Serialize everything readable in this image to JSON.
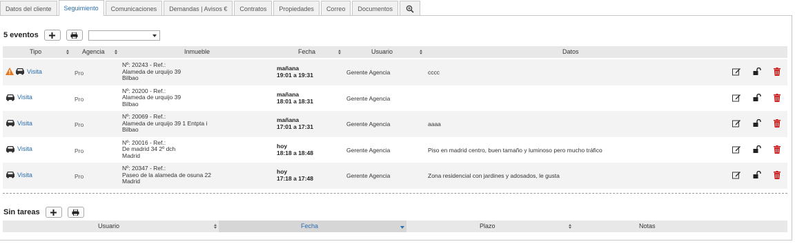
{
  "tabs": [
    {
      "label": "Datos del cliente"
    },
    {
      "label": "Seguimiento"
    },
    {
      "label": "Comunicaciones"
    },
    {
      "label": "Demandas | Avisos €"
    },
    {
      "label": "Contratos"
    },
    {
      "label": "Propiedades"
    },
    {
      "label": "Correo"
    },
    {
      "label": "Documentos"
    },
    {
      "icon": "zoom-icon"
    }
  ],
  "active_tab": "Seguimiento",
  "events": {
    "title": "5 eventos",
    "filter_value": "",
    "columns": {
      "tipo": "Tipo",
      "agencia": "Agencia",
      "inmueble": "Inmueble",
      "fecha": "Fecha",
      "usuario": "Usuario",
      "datos": "Datos"
    },
    "rows": [
      {
        "warning": true,
        "tipo": "Visita",
        "agencia": "Pro",
        "inm1": "Nº: 20243 - Ref.:",
        "inm2": "Alameda de urquijo 39",
        "inm3": "Bilbao",
        "fecha1": "mañana",
        "fecha2": "19:01 a 19:31",
        "usuario": "Gerente Agencia",
        "datos": "cccc"
      },
      {
        "warning": false,
        "tipo": "Visita",
        "agencia": "Pro",
        "inm1": "Nº: 20200 - Ref.:",
        "inm2": "Alameda de urquijo 39",
        "inm3": "Bilbao",
        "fecha1": "mañana",
        "fecha2": "18:01 a 18:31",
        "usuario": "Gerente Agencia",
        "datos": ""
      },
      {
        "warning": false,
        "tipo": "Visita",
        "agencia": "Pro",
        "inm1": "Nº: 20069 - Ref.:",
        "inm2": "Alameda de urquijo 39 1 Entpta i",
        "inm3": "Bilbao",
        "fecha1": "mañana",
        "fecha2": "17:01 a 17:31",
        "usuario": "Gerente Agencia",
        "datos": "aaaa"
      },
      {
        "warning": false,
        "tipo": "Visita",
        "agencia": "Pro",
        "inm1": "Nº: 20016 - Ref.:",
        "inm2": "De madrid 34 2º dch",
        "inm3": "Madrid",
        "fecha1": "hoy",
        "fecha2": "18:18 a 18:48",
        "usuario": "Gerente Agencia",
        "datos": "Piso en madrid centro, buen tamaño y luminoso pero mucho tráfico"
      },
      {
        "warning": false,
        "tipo": "Visita",
        "agencia": "Pro",
        "inm1": "Nº: 20347 - Ref.:",
        "inm2": "Paseo de la alameda de osuna 22",
        "inm3": "Madrid",
        "fecha1": "hoy",
        "fecha2": "17:18 a 17:48",
        "usuario": "Gerente Agencia",
        "datos": "Zona residencial con jardines y adosados, le gusta"
      }
    ]
  },
  "tasks": {
    "title": "Sin tareas",
    "columns": {
      "usuario": "Usuario",
      "fecha": "Fecha",
      "plazo": "Plazo",
      "notas": "Notas"
    }
  },
  "colors": {
    "accent": "#2a6db0",
    "warning": "#e8751a",
    "delete": "#cc1111"
  }
}
